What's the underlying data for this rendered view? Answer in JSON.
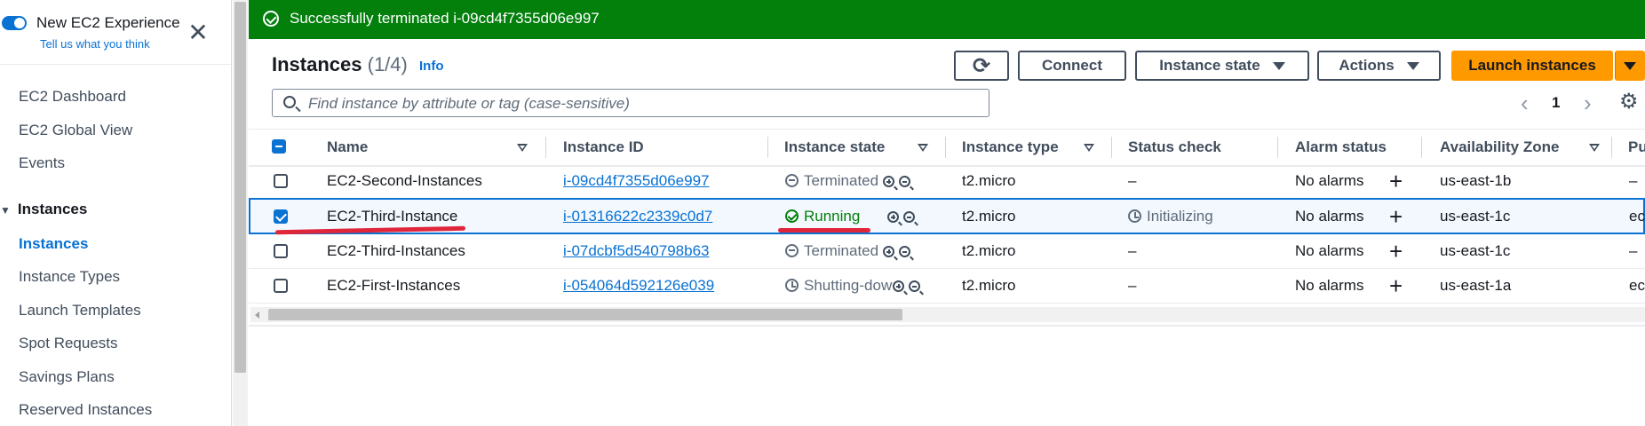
{
  "sidebar": {
    "experience_title": "New EC2 Experience",
    "experience_sub": "Tell us what you think",
    "close": "✕",
    "items": [
      "EC2 Dashboard",
      "EC2 Global View",
      "Events"
    ],
    "section": "Instances",
    "section_items": [
      "Instances",
      "Instance Types",
      "Launch Templates",
      "Spot Requests",
      "Savings Plans",
      "Reserved Instances"
    ]
  },
  "banner": {
    "text": "Successfully terminated i-09cd4f7355d06e997"
  },
  "header": {
    "title": "Instances",
    "count": "(1/4)",
    "info": "Info",
    "refresh": "⟳",
    "connect": "Connect",
    "instance_state": "Instance state",
    "actions": "Actions",
    "launch": "Launch instances"
  },
  "search": {
    "placeholder": "Find instance by attribute or tag (case-sensitive)"
  },
  "pager": {
    "prev": "‹",
    "page": "1",
    "next": "›",
    "settings": "⚙"
  },
  "columns": [
    "Name",
    "Instance ID",
    "Instance state",
    "Instance type",
    "Status check",
    "Alarm status",
    "Availability Zone",
    "Pu"
  ],
  "rows": [
    {
      "name": "EC2-Second-Instances",
      "id": "i-09cd4f7355d06e997",
      "state": "Terminated",
      "type": "t2.micro",
      "status": "–",
      "alarm": "No alarms",
      "az": "us-east-1b",
      "pub": "–"
    },
    {
      "name": "EC2-Third-Instance",
      "id": "i-01316622c2339c0d7",
      "state": "Running",
      "type": "t2.micro",
      "status": "Initializing",
      "alarm": "No alarms",
      "az": "us-east-1c",
      "pub": "ec"
    },
    {
      "name": "EC2-Third-Instances",
      "id": "i-07dcbf5d540798b63",
      "state": "Terminated",
      "type": "t2.micro",
      "status": "–",
      "alarm": "No alarms",
      "az": "us-east-1c",
      "pub": "–"
    },
    {
      "name": "EC2-First-Instances",
      "id": "i-054064d592126e039",
      "state": "Shutting-dow",
      "type": "t2.micro",
      "status": "–",
      "alarm": "No alarms",
      "az": "us-east-1a",
      "pub": "ec"
    }
  ],
  "colors": {
    "accent": "#0972d3",
    "success": "#037f0c",
    "primary_button": "#ff9900",
    "annotation": "#e0263b"
  }
}
